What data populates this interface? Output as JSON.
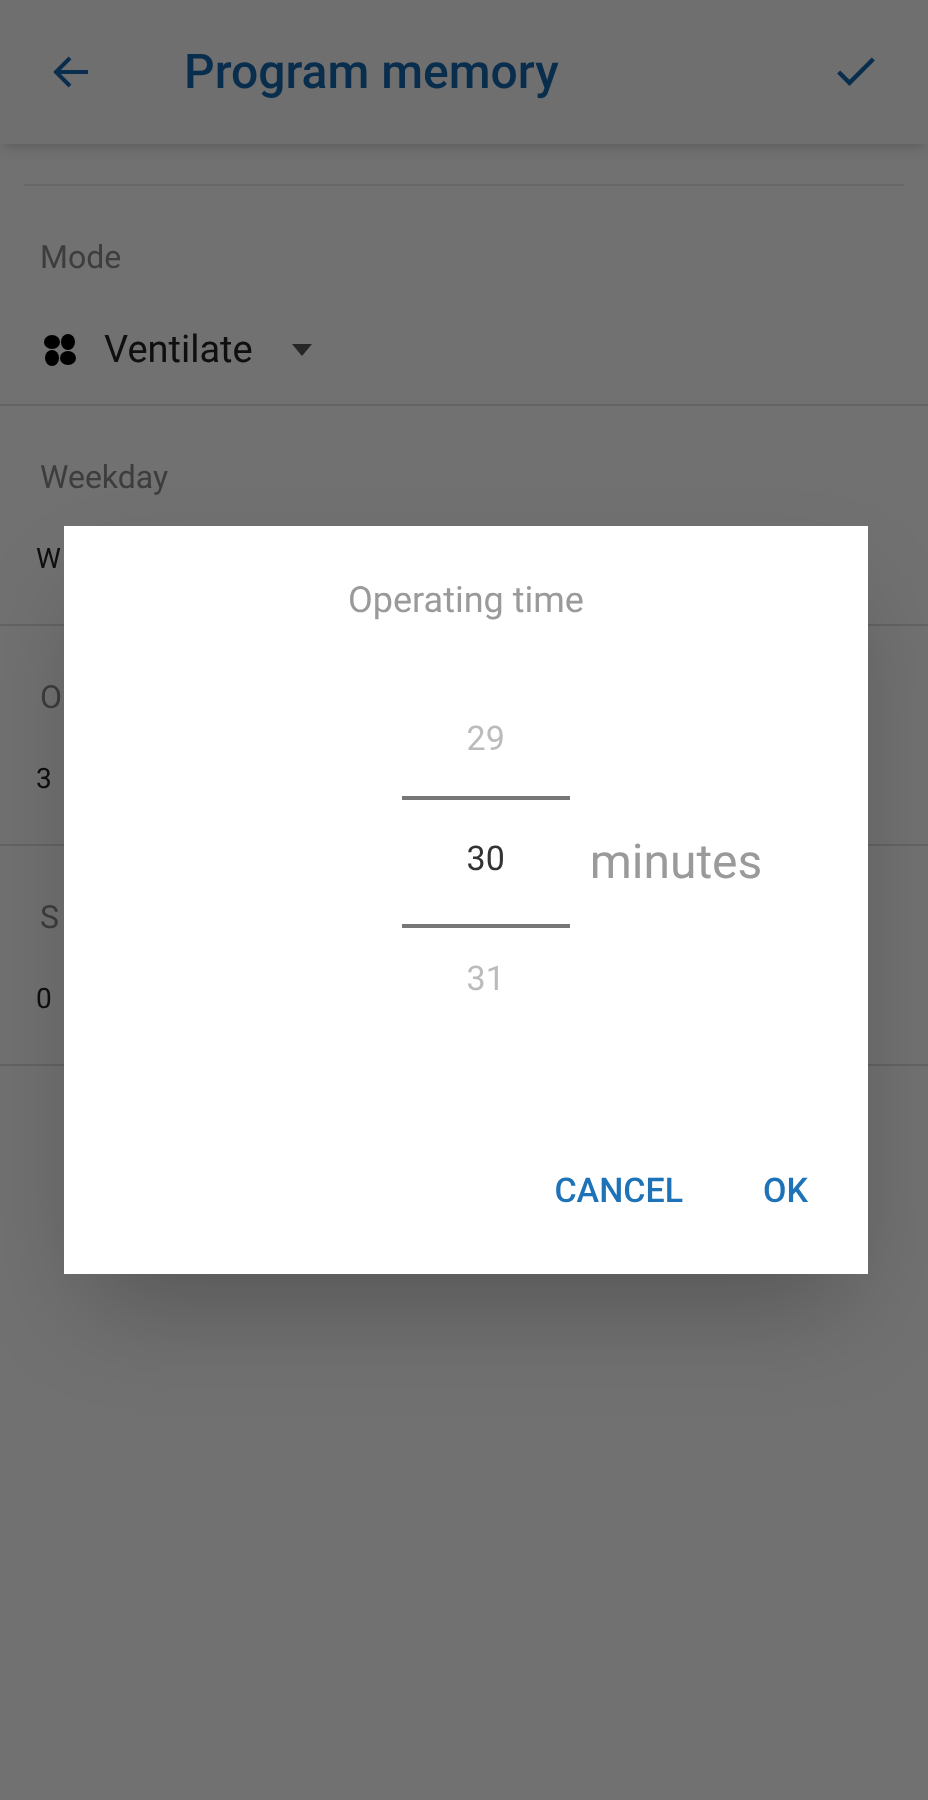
{
  "app_bar": {
    "title": "Program memory"
  },
  "fields": [
    {
      "label": "Mode",
      "value": "Ventilate",
      "kind": "dropdown"
    },
    {
      "label": "Weekday",
      "value": "W",
      "kind": "text"
    },
    {
      "label": "O",
      "value": "3",
      "kind": "text"
    },
    {
      "label": "S",
      "value": "0",
      "kind": "text"
    }
  ],
  "dialog": {
    "title": "Operating time",
    "picker": [
      {
        "value": "29",
        "selected": false
      },
      {
        "value": "30",
        "selected": true
      },
      {
        "value": "31",
        "selected": false
      }
    ],
    "unit": "minutes",
    "buttons": [
      "CANCEL",
      "OK"
    ]
  }
}
